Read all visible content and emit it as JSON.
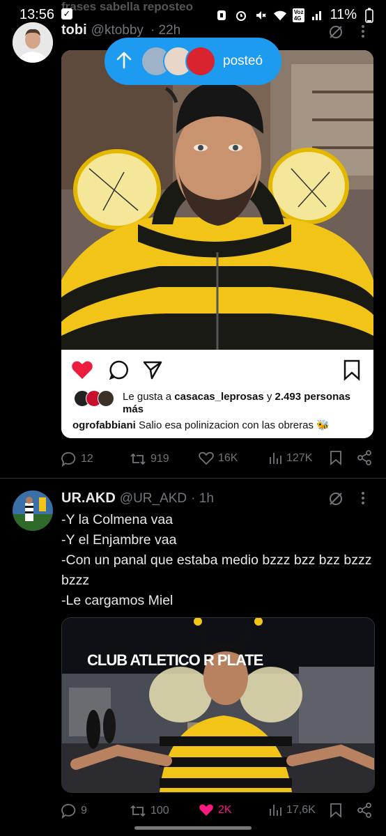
{
  "status_bar": {
    "time": "13:56",
    "behind_text": "frases sabella reposteo",
    "battery": "11%",
    "net_label_top": "Voz",
    "net_label_bottom": "4G"
  },
  "posted_pill": {
    "label": "posteó"
  },
  "tweet1": {
    "name": "tobi",
    "handle": "@ktobby",
    "time": "· 22h",
    "instagram": {
      "likes_prefix": "Le gusta a ",
      "likes_user": "casacas_leprosas",
      "likes_mid": " y ",
      "likes_count": "2.493 personas",
      "likes_suffix": "más",
      "caption_user": "ogrofabbiani",
      "caption_text": " Salio esa polinizacion con las obreras 🐝"
    },
    "stats": {
      "replies": "12",
      "reposts": "919",
      "likes": "16K",
      "views": "127K"
    }
  },
  "tweet2": {
    "name": "UR.AKD",
    "handle": "@UR_AKD",
    "time": "· 1h",
    "text": "-Y la Colmena vaa\n-Y el Enjambre vaa\n-Con un panal que estaba medio bzzz bzz bzz bzzz bzzz\n-Le cargamos Miel",
    "video_sign": "CLUB ATLETICO R PLATE",
    "stats": {
      "replies": "9",
      "reposts": "100",
      "likes": "2K",
      "views": "17,6K"
    }
  },
  "colors": {
    "accent": "#1d9bf0",
    "like_pink": "#f91880",
    "bee_yellow": "#f2c418"
  }
}
